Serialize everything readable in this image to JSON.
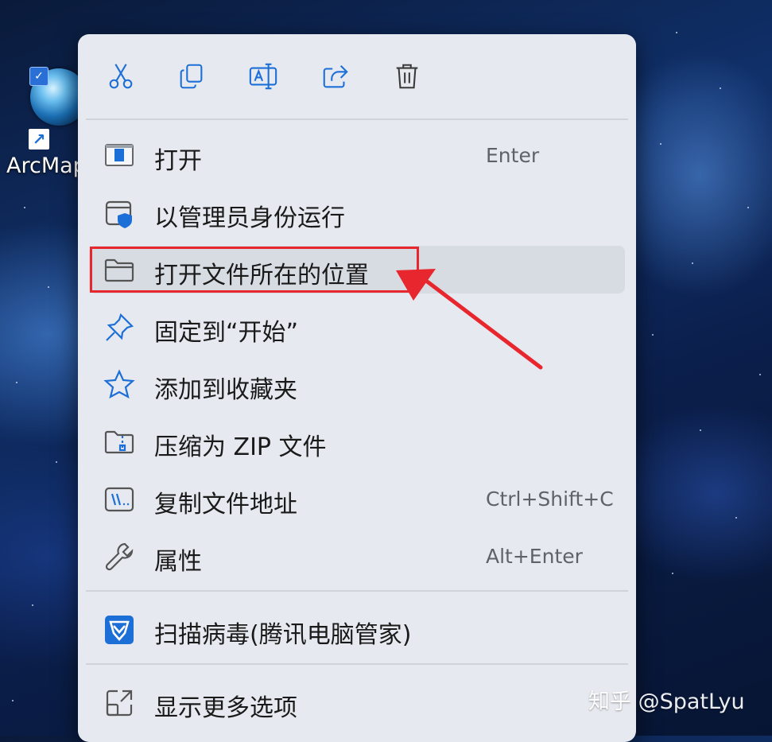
{
  "desktop": {
    "icon_label": "ArcMap"
  },
  "menu": {
    "toolbar": [
      {
        "id": "cut",
        "icon": "scissors-icon"
      },
      {
        "id": "copy",
        "icon": "copy-icon"
      },
      {
        "id": "rename",
        "icon": "rename-icon"
      },
      {
        "id": "share",
        "icon": "share-icon"
      },
      {
        "id": "delete",
        "icon": "trash-icon"
      }
    ],
    "items": [
      {
        "label": "打开",
        "shortcut": "Enter",
        "icon": "open-app-icon"
      },
      {
        "label": "以管理员身份运行",
        "shortcut": "",
        "icon": "run-as-admin-shield-icon"
      },
      {
        "label": "打开文件所在的位置",
        "shortcut": "",
        "icon": "folder-icon",
        "highlighted": true
      },
      {
        "label": "固定到“开始”",
        "shortcut": "",
        "icon": "pin-icon"
      },
      {
        "label": "添加到收藏夹",
        "shortcut": "",
        "icon": "star-icon"
      },
      {
        "label": "压缩为 ZIP 文件",
        "shortcut": "",
        "icon": "zip-folder-icon"
      },
      {
        "label": "复制文件地址",
        "shortcut": "Ctrl+Shift+C",
        "icon": "copy-path-icon"
      },
      {
        "label": "属性",
        "shortcut": "Alt+Enter",
        "icon": "wrench-icon"
      },
      {
        "label": "扫描病毒(腾讯电脑管家)",
        "shortcut": "",
        "icon": "tencent-shield-icon"
      },
      {
        "label": "显示更多选项",
        "shortcut": "",
        "icon": "show-more-options-icon"
      }
    ]
  },
  "annotation": {
    "color": "#e8262d"
  },
  "watermark": "知乎 @SpatLyu",
  "colors": {
    "accent_blue": "#1d6fd8",
    "menu_bg": "#e6e9ef",
    "highlight_bg": "#d7dbe2"
  }
}
